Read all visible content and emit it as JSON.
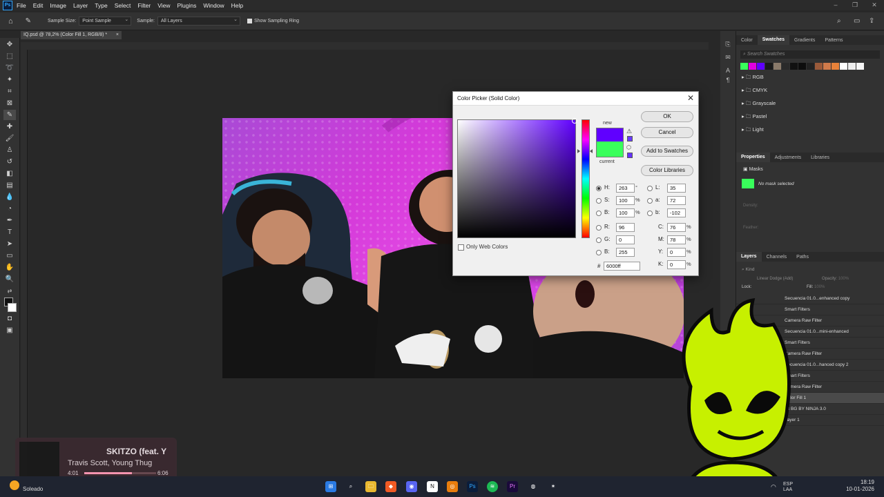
{
  "app": {
    "logo": "Ps"
  },
  "menu": [
    "File",
    "Edit",
    "Image",
    "Layer",
    "Type",
    "Select",
    "Filter",
    "View",
    "Plugins",
    "Window",
    "Help"
  ],
  "options": {
    "sample_size_label": "Sample Size:",
    "sample_size_value": "Point Sample",
    "sample_label": "Sample:",
    "sample_value": "All Layers",
    "sampling_ring_label": "Show Sampling Ring"
  },
  "document_tab": "IQ.psd @ 78,2% (Color Fill 1, RGB/8) *",
  "color_picker": {
    "title": "Color Picker (Solid Color)",
    "new_label": "new",
    "current_label": "current",
    "new_color": "#6000ff",
    "current_color": "#39ff5b",
    "ok": "OK",
    "cancel": "Cancel",
    "add_to_swatches": "Add to Swatches",
    "color_libraries": "Color Libraries",
    "only_web_colors": "Only Web Colors",
    "H": "263",
    "S": "100",
    "B": "100",
    "R": "96",
    "G": "0",
    "Bv": "255",
    "L": "35",
    "a": "72",
    "b": "-102",
    "C": "76",
    "M": "78",
    "Y": "0",
    "K": "0",
    "hex": "6000ff",
    "deg": "°",
    "pct": "%"
  },
  "swatches_panel": {
    "tabs": [
      "Color",
      "Swatches",
      "Gradients",
      "Patterns"
    ],
    "search_placeholder": "Search Swatches",
    "colors": [
      "#39ff5b",
      "#e000e0",
      "#6000ff",
      "#1a1a1a",
      "#8a7a6a",
      "#2a2a2a",
      "#111111",
      "#0d0d0d",
      "#222222",
      "#9a5a3a",
      "#d07a4a",
      "#e8823a",
      "#ffffff",
      "#eeeeee",
      "#f5f5f5"
    ],
    "folders": [
      "RGB",
      "CMYK",
      "Grayscale",
      "Pastel",
      "Light"
    ]
  },
  "properties_panel": {
    "tabs": [
      "Properties",
      "Adjustments",
      "Libraries"
    ],
    "masks_label": "Masks",
    "no_mask": "No mask selected",
    "density": "Density:",
    "feather": "Feather:"
  },
  "layers_panel": {
    "tabs": [
      "Layers",
      "Channels",
      "Paths"
    ],
    "kind": "Kind",
    "blend": "Linear Dodge (Add)",
    "opacity_label": "Opacity:",
    "opacity_value": "100%",
    "lock_label": "Lock:",
    "fill_label": "Fill:",
    "fill_value": "100%",
    "layers": [
      "Secuencia 01.0...enhanced copy",
      "Smart Filters",
      "Camera Raw Filter",
      "Secuencia 01.0...mini-enhanced",
      "Smart Filters",
      "Camera Raw Filter",
      "Secuencia 01.0...hanced copy 2",
      "Smart Filters",
      "Camera Raw Filter",
      "Color Fill 1",
      "83 BG BY NINJA 3.0",
      "Layer 1"
    ]
  },
  "music": {
    "title": "SKITZO (feat. Y",
    "artist": "Travis Scott, Young Thug",
    "elapsed": "4:01",
    "total": "6:06",
    "progress": 0.66
  },
  "taskbar": {
    "weather": "Soleado",
    "lang1": "ESP",
    "lang2": "LAA",
    "time": "18:19",
    "date": "10-01-2026"
  }
}
